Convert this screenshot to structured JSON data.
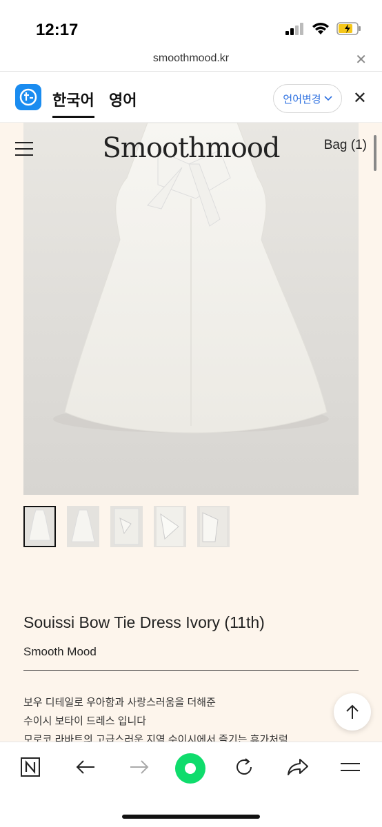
{
  "status": {
    "time": "12:17"
  },
  "browser": {
    "url": "smoothmood.kr"
  },
  "translate": {
    "lang_korean": "한국어",
    "lang_english": "영어",
    "change_label": "언어변경"
  },
  "site": {
    "brand": "Smoothmood",
    "bag_label": "Bag (1)"
  },
  "product": {
    "title": "Souissi Bow Tie Dress Ivory (11th)",
    "brand": "Smooth Mood",
    "description": [
      "보우 디테일로 우아함과 사랑스러움을 더해준",
      "수이시 보타이 드레스 입니다",
      "모로코 라바트의 고급스러운 지역 수이시에서 즐기는 휴가처럼"
    ],
    "thumbnail_count": 5,
    "selected_thumbnail": 1
  },
  "colors": {
    "accent_blue": "#2b6fe0",
    "page_bg": "#fdf5ec",
    "green_button": "#0fdc6c"
  },
  "icons": [
    "naver-n-icon",
    "back-arrow-icon",
    "forward-arrow-icon",
    "green-home-icon",
    "reload-icon",
    "share-icon",
    "menu-icon",
    "arrow-up-icon",
    "close-icon",
    "chevron-down-icon",
    "hamburger-icon",
    "signal-icon",
    "wifi-icon",
    "battery-icon"
  ]
}
